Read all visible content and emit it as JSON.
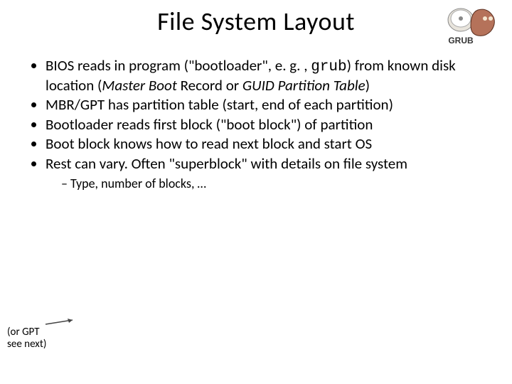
{
  "title": "File System Layout",
  "logo": {
    "name": "grub-logo",
    "label": "GRUB"
  },
  "bullets": {
    "b1_pre": "BIOS reads in program (\"bootloader\", e. g. , ",
    "b1_code": "grub",
    "b1_mid": ") from  known disk location (",
    "b1_it1": "Master Boot ",
    "b1_plain": "Record or ",
    "b1_it2": "GUID Partition Table",
    "b1_end": ")",
    "b2": "MBR/GPT has partition table (start, end of each partition)",
    "b3": "Bootloader reads first block (\"boot block\") of partition",
    "b4": "Boot block knows how to read next block and start OS",
    "b5": "Rest can vary. Often \"superblock\" with details on file system",
    "sub1": "Type, number of blocks, …"
  },
  "footnote": {
    "line1": "(or GPT",
    "line2": "see next)"
  }
}
